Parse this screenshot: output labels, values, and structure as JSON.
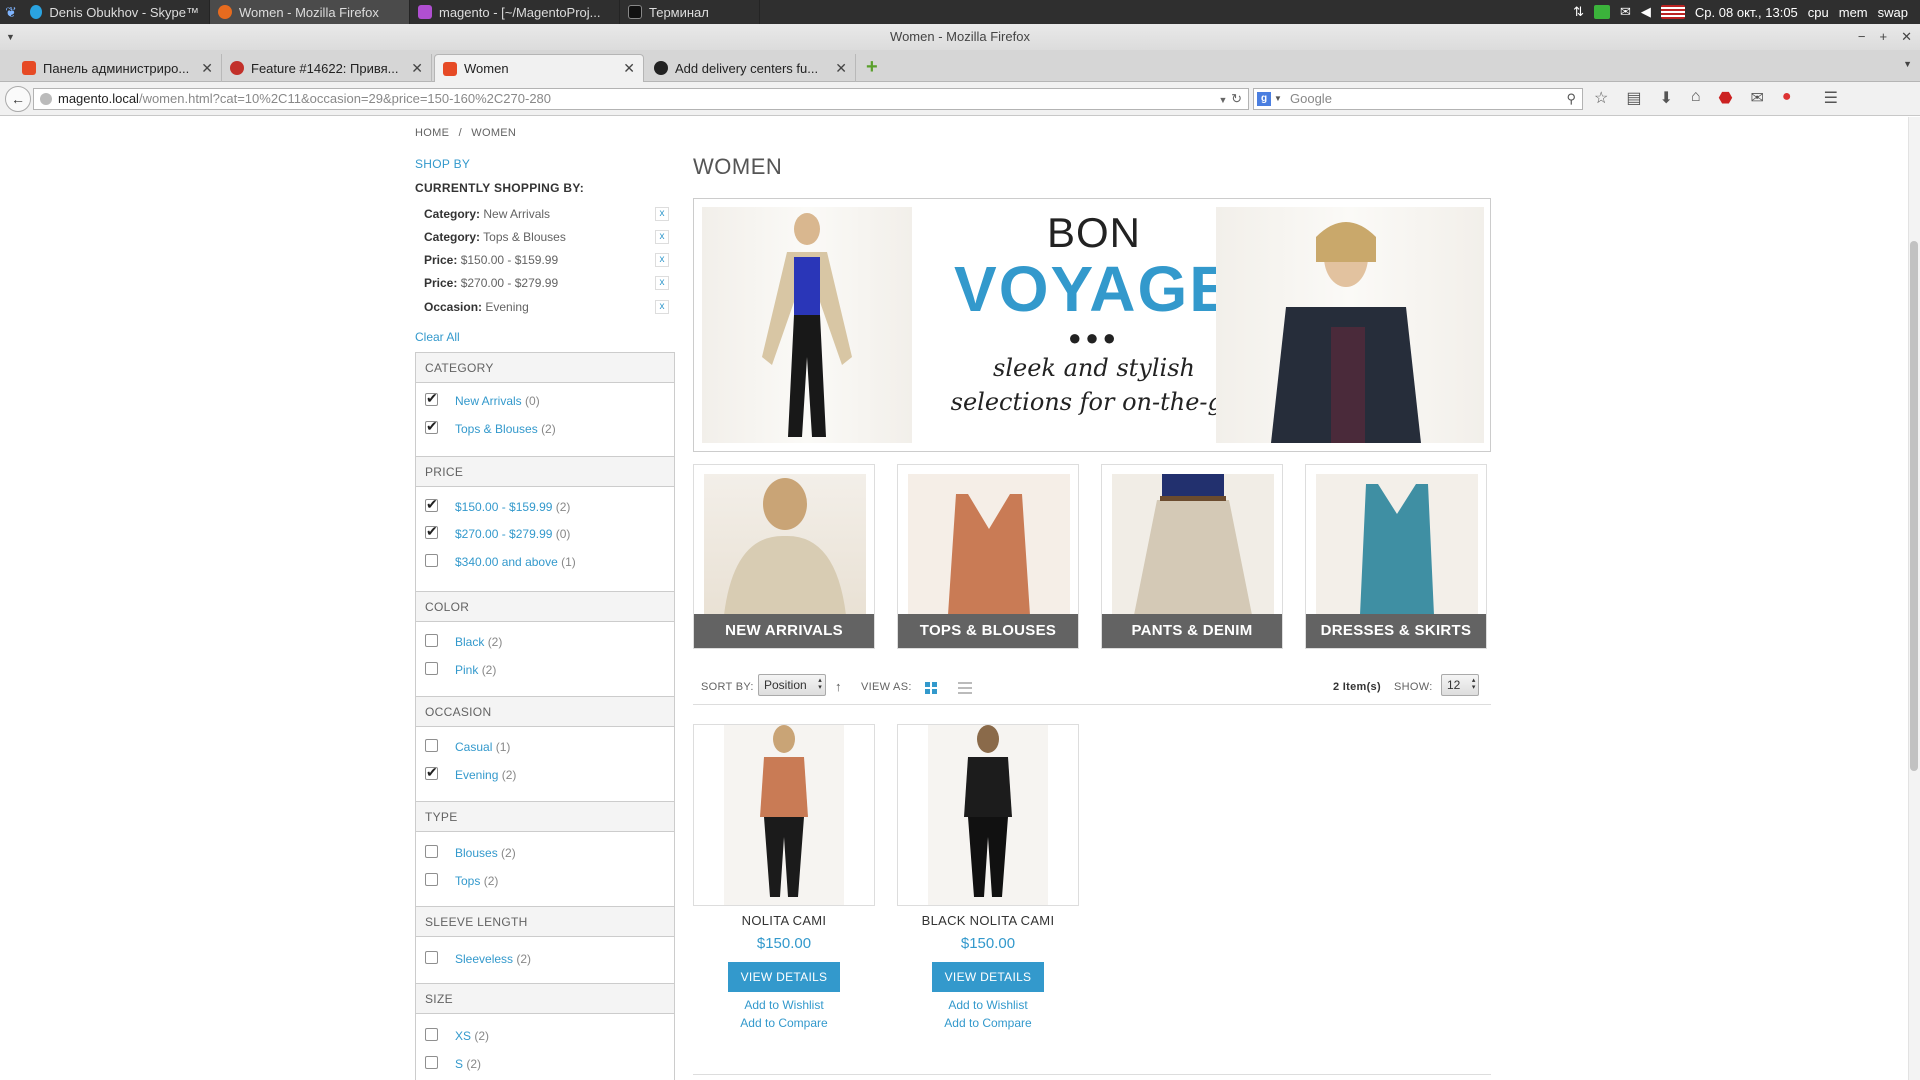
{
  "taskbar": {
    "tasks": [
      {
        "label": "Denis Obukhov - Skype™"
      },
      {
        "label": "Women - Mozilla Firefox"
      },
      {
        "label": "magento - [~/MagentoProj..."
      },
      {
        "label": "Терминал"
      }
    ],
    "clock": "Ср. 08 окт., 13:05",
    "cpu": "cpu",
    "mem": "mem",
    "swap": "swap"
  },
  "window": {
    "title": "Women - Mozilla Firefox"
  },
  "tabs": [
    {
      "label": "Панель администриро..."
    },
    {
      "label": "Feature #14622: Привя..."
    },
    {
      "label": "Women"
    },
    {
      "label": "Add delivery centers fu..."
    }
  ],
  "navbar": {
    "url_host": "magento.local",
    "url_path": "/women.html?cat=10%2C11&occasion=29&price=150-160%2C270-280",
    "search_placeholder": "Google"
  },
  "breadcrumb": {
    "home": "HOME",
    "sep": "/",
    "current": "WOMEN"
  },
  "sidebar": {
    "shop_by": "SHOP BY",
    "currently_title": "CURRENTLY SHOPPING BY:",
    "active_filters": [
      {
        "label": "Category:",
        "value": "New Arrivals"
      },
      {
        "label": "Category:",
        "value": "Tops & Blouses"
      },
      {
        "label": "Price:",
        "value": "$150.00 - $159.99"
      },
      {
        "label": "Price:",
        "value": "$270.00 - $279.99"
      },
      {
        "label": "Occasion:",
        "value": "Evening"
      }
    ],
    "remove_icon": "x",
    "clear_all": "Clear All",
    "blocks": [
      {
        "title": "CATEGORY",
        "items": [
          {
            "label": "New Arrivals",
            "count": "(0)",
            "checked": true
          },
          {
            "label": "Tops & Blouses",
            "count": "(2)",
            "checked": true
          }
        ]
      },
      {
        "title": "PRICE",
        "items": [
          {
            "label": "$150.00 - $159.99",
            "count": "(2)",
            "checked": true
          },
          {
            "label": "$270.00 - $279.99",
            "count": "(0)",
            "checked": true
          },
          {
            "label": "$340.00 and above",
            "count": "(1)",
            "checked": false
          }
        ]
      },
      {
        "title": "COLOR",
        "items": [
          {
            "label": "Black",
            "count": "(2)",
            "checked": false
          },
          {
            "label": "Pink",
            "count": "(2)",
            "checked": false
          }
        ]
      },
      {
        "title": "OCCASION",
        "items": [
          {
            "label": "Casual",
            "count": "(1)",
            "checked": false
          },
          {
            "label": "Evening",
            "count": "(2)",
            "checked": true
          }
        ]
      },
      {
        "title": "TYPE",
        "items": [
          {
            "label": "Blouses",
            "count": "(2)",
            "checked": false
          },
          {
            "label": "Tops",
            "count": "(2)",
            "checked": false
          }
        ]
      },
      {
        "title": "SLEEVE LENGTH",
        "items": [
          {
            "label": "Sleeveless",
            "count": "(2)",
            "checked": false
          }
        ]
      },
      {
        "title": "SIZE",
        "items": [
          {
            "label": "XS",
            "count": "(2)",
            "checked": false
          },
          {
            "label": "S",
            "count": "(2)",
            "checked": false
          }
        ]
      }
    ]
  },
  "main": {
    "title": "WOMEN",
    "banner": {
      "line1": "BON",
      "line2": "VOYAGE",
      "dots": "●●●",
      "tagline1": "sleek and stylish",
      "tagline2": "selections for on-the-go"
    },
    "categories": [
      {
        "label": "NEW ARRIVALS"
      },
      {
        "label": "TOPS & BLOUSES"
      },
      {
        "label": "PANTS & DENIM"
      },
      {
        "label": "DRESSES & SKIRTS"
      }
    ],
    "toolbar": {
      "sort_by": "SORT BY:",
      "sort_value": "Position",
      "sort_dir_icon": "↑",
      "view_as": "VIEW AS:",
      "count": "2 Item(s)",
      "show": "SHOW:",
      "show_value": "12"
    },
    "products": [
      {
        "name": "NOLITA CAMI",
        "price": "$150.00",
        "button": "VIEW DETAILS",
        "wishlist": "Add to Wishlist",
        "compare": "Add to Compare",
        "top_color": "#c97b55"
      },
      {
        "name": "BLACK NOLITA CAMI",
        "price": "$150.00",
        "button": "VIEW DETAILS",
        "wishlist": "Add to Wishlist",
        "compare": "Add to Compare",
        "top_color": "#1c1c1c"
      }
    ]
  },
  "colors": {
    "accent": "#3399cc",
    "category_label_bg": "#636363"
  }
}
